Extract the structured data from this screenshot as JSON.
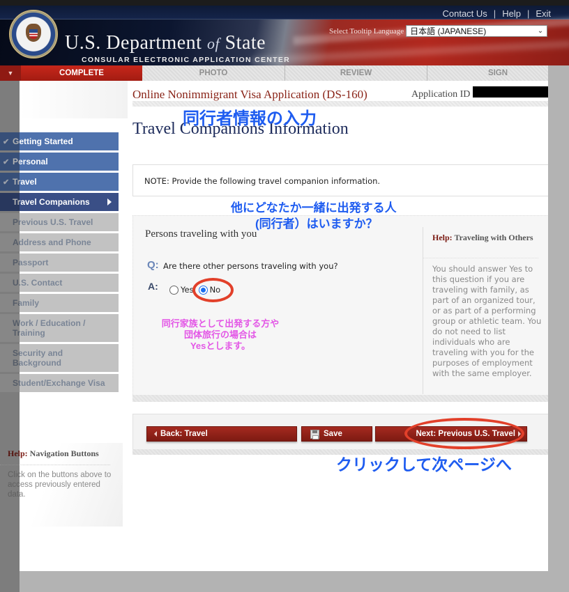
{
  "header": {
    "brand_title_main": "U.S. Department ",
    "brand_title_of": "of",
    "brand_title_end": " State",
    "brand_subtitle": "CONSULAR ELECTRONIC APPLICATION CENTER",
    "links": [
      "Contact Us",
      "Help",
      "Exit"
    ],
    "tooltip_language_label": "Select Tooltip Language",
    "tooltip_language_value": "日本語 (JAPANESE)"
  },
  "steps": {
    "active_index": 0,
    "items": [
      "COMPLETE",
      "PHOTO",
      "REVIEW",
      "SIGN"
    ]
  },
  "application": {
    "title": "Online Nonimmigrant Visa Application (DS-160)",
    "id_label": "Application ID",
    "id_value_redacted": true
  },
  "page": {
    "heading": "Travel Companions Information",
    "note": "NOTE: Provide the following travel companion information."
  },
  "sidebar": {
    "items": [
      {
        "label": "Getting Started",
        "status": "done"
      },
      {
        "label": "Personal",
        "status": "done"
      },
      {
        "label": "Travel",
        "status": "done"
      },
      {
        "label": "Travel Companions",
        "status": "current"
      },
      {
        "label": "Previous U.S. Travel",
        "status": "todo"
      },
      {
        "label": "Address and Phone",
        "status": "todo"
      },
      {
        "label": "Passport",
        "status": "todo"
      },
      {
        "label": "U.S. Contact",
        "status": "todo"
      },
      {
        "label": "Family",
        "status": "todo"
      },
      {
        "label": "Work / Education / Training",
        "status": "todo"
      },
      {
        "label": "Security and Background",
        "status": "todo"
      },
      {
        "label": "Student/Exchange Visa",
        "status": "todo"
      }
    ],
    "help": {
      "prefix": "Help:",
      "title": "Navigation Buttons",
      "text": "Click on the buttons above to access previously entered data."
    }
  },
  "question": {
    "section_title": "Persons traveling with you",
    "q_label": "Q:",
    "q_text": "Are there other persons traveling with you?",
    "a_label": "A:",
    "options": [
      "Yes",
      "No"
    ],
    "selected": "No",
    "help": {
      "prefix": "Help:",
      "title": "Traveling with Others",
      "text": "You should answer Yes to this question if you are traveling with family, as part of an organized tour, or as part of a performing group or athletic team. You do not need to list individuals who are traveling with you for the purposes of employment with the same employer."
    }
  },
  "buttons": {
    "back": "Back: Travel",
    "save": "Save",
    "next": "Next: Previous U.S. Travel"
  },
  "annotations": {
    "title_jp": "同行者情報の入力",
    "question_jp_line1": "他にどなたか一緒に出発する人",
    "question_jp_line2": "(同行者）はいますか？",
    "hint_jp_line1": "同行家族として出発する方や",
    "hint_jp_line2": "団体旅行の場合は",
    "hint_jp_line3": "Yesとします。",
    "next_jp": "クリックして次ページへ",
    "blue_color": "#1e5cf0",
    "pink_color": "#e357e6",
    "ring_color": "#e2402a"
  }
}
